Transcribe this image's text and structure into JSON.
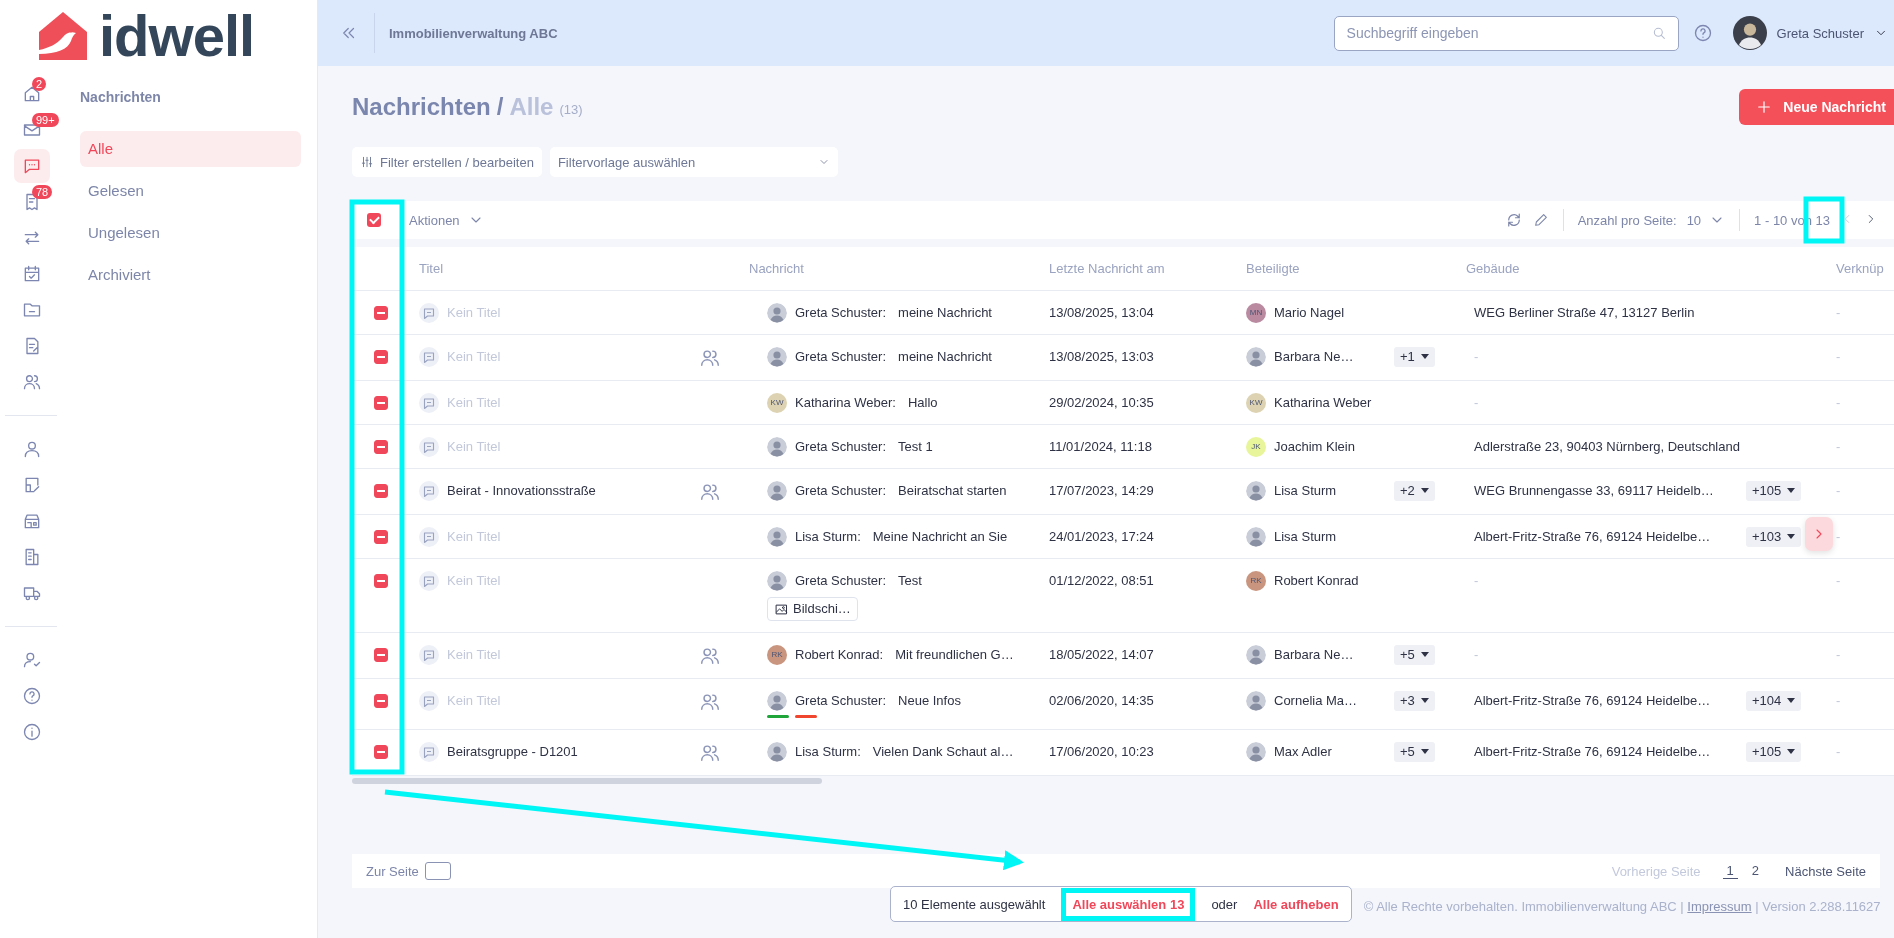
{
  "logo": {
    "text": "idwell"
  },
  "rail": {
    "groups": [
      [
        {
          "kind": "home",
          "badge": "2",
          "selected": false
        },
        {
          "kind": "mail",
          "badge": "99+",
          "selected": false
        },
        {
          "kind": "chat",
          "selected": true
        },
        {
          "kind": "receipt",
          "badge": "78",
          "selected": false
        },
        {
          "kind": "transfer",
          "selected": false
        },
        {
          "kind": "calendar",
          "selected": false
        },
        {
          "kind": "folder",
          "selected": false
        },
        {
          "kind": "document",
          "selected": false
        },
        {
          "kind": "users",
          "selected": false
        }
      ],
      [
        {
          "kind": "person",
          "selected": false
        },
        {
          "kind": "clipboard",
          "selected": false
        },
        {
          "kind": "store",
          "selected": false
        },
        {
          "kind": "building",
          "selected": false
        },
        {
          "kind": "truck",
          "selected": false
        }
      ],
      [
        {
          "kind": "usercheck",
          "selected": false
        },
        {
          "kind": "help",
          "selected": false
        },
        {
          "kind": "info",
          "selected": false
        }
      ]
    ]
  },
  "subnav": {
    "title": "Nachrichten",
    "items": [
      {
        "label": "Alle",
        "selected": true
      },
      {
        "label": "Gelesen",
        "selected": false
      },
      {
        "label": "Ungelesen",
        "selected": false
      },
      {
        "label": "Archiviert",
        "selected": false
      }
    ]
  },
  "header": {
    "account": "Immobilienverwaltung ABC",
    "search": {
      "placeholder": "Suchbegriff eingeben"
    },
    "user": {
      "name": "Greta Schuster"
    }
  },
  "page": {
    "title": "Nachrichten",
    "separator": "/",
    "subtitle": "Alle",
    "count": "(13)",
    "new_button": "Neue Nachricht"
  },
  "filters": {
    "edit_button": "Filter erstellen / bearbeiten",
    "template": {
      "placeholder": "Filtervorlage auswählen"
    }
  },
  "toolbar": {
    "all_checked": true,
    "actions": "Aktionen",
    "per_page_label": "Anzahl pro Seite:",
    "per_page": "10",
    "range": "1 - 10 von 13",
    "prev_disabled": true
  },
  "table": {
    "columns": [
      "Titel",
      "Nachricht",
      "Letzte Nachricht am",
      "Beteiligte",
      "Gebäude",
      "Verknüp"
    ],
    "rows": [
      {
        "selected": true,
        "title": "Kein Titel",
        "untitled": true,
        "group": false,
        "avatar": {
          "kind": "photo"
        },
        "sender": "Greta Schuster:",
        "message": "meine Nachricht",
        "date": "13/08/2025, 13:04",
        "participant": {
          "name": "Mario Nagel",
          "avatar": {
            "kind": "initials",
            "initials": "MN",
            "color": "#b98aa0"
          }
        },
        "building": "WEG Berliner Straße 47, 13127 Berlin",
        "linked": "-"
      },
      {
        "selected": true,
        "title": "Kein Titel",
        "untitled": true,
        "group": true,
        "avatar": {
          "kind": "photo"
        },
        "sender": "Greta Schuster:",
        "message": "meine Nachricht",
        "date": "13/08/2025, 13:03",
        "participant": {
          "name": "Barbara Ne…",
          "avatar": {
            "kind": "photo"
          }
        },
        "more_participants": "+1",
        "building": "-",
        "linked": "-"
      },
      {
        "selected": true,
        "title": "Kein Titel",
        "untitled": true,
        "group": false,
        "avatar": {
          "kind": "initials",
          "initials": "KW",
          "color": "#ddd3b3"
        },
        "sender": "Katharina Weber:",
        "message": "Hallo",
        "date": "29/02/2024, 10:35",
        "participant": {
          "name": "Katharina Weber",
          "avatar": {
            "kind": "initials",
            "initials": "KW",
            "color": "#ddd3b3"
          }
        },
        "building": "-",
        "linked": "-"
      },
      {
        "selected": true,
        "title": "Kein Titel",
        "untitled": true,
        "group": false,
        "avatar": {
          "kind": "photo"
        },
        "sender": "Greta Schuster:",
        "message": "Test 1",
        "date": "11/01/2024, 11:18",
        "participant": {
          "name": "Joachim Klein",
          "avatar": {
            "kind": "initials",
            "initials": "JK",
            "color": "#e8f59a"
          }
        },
        "building": "Adlerstraße 23, 90403 Nürnberg, Deutschland",
        "linked": "-"
      },
      {
        "selected": true,
        "title": "Beirat - Innovationsstraße",
        "untitled": false,
        "group": true,
        "avatar": {
          "kind": "photo"
        },
        "sender": "Greta Schuster:",
        "message": "Beiratschat starten",
        "date": "17/07/2023, 14:29",
        "participant": {
          "name": "Lisa Sturm",
          "avatar": {
            "kind": "photo"
          }
        },
        "more_participants": "+2",
        "building": "WEG Brunnengasse 33, 69117 Heidelb…",
        "more_buildings": "+105",
        "linked": "-"
      },
      {
        "selected": true,
        "title": "Kein Titel",
        "untitled": true,
        "group": false,
        "avatar": {
          "kind": "photo"
        },
        "sender": "Lisa Sturm:",
        "message": "Meine Nachricht an Sie",
        "date": "24/01/2023, 17:24",
        "participant": {
          "name": "Lisa Sturm",
          "avatar": {
            "kind": "photo"
          }
        },
        "building": "Albert-Fritz-Straße 76, 69124 Heidelbe…",
        "more_buildings": "+103",
        "linked": "-"
      },
      {
        "selected": true,
        "title": "Kein Titel",
        "untitled": true,
        "group": false,
        "avatar": {
          "kind": "photo"
        },
        "sender": "Greta Schuster:",
        "message": "Test",
        "attachment": "Bildschi…",
        "date": "01/12/2022, 08:51",
        "participant": {
          "name": "Robert Konrad",
          "avatar": {
            "kind": "initials",
            "initials": "RK",
            "color": "#c9957f"
          }
        },
        "building": "-",
        "linked": "-"
      },
      {
        "selected": true,
        "title": "Kein Titel",
        "untitled": true,
        "group": true,
        "avatar": {
          "kind": "initials",
          "initials": "RK",
          "color": "#c9957f"
        },
        "sender": "Robert Konrad:",
        "message": "Mit freundlichen G…",
        "date": "18/05/2022, 14:07",
        "participant": {
          "name": "Barbara Ne…",
          "avatar": {
            "kind": "photo"
          }
        },
        "more_participants": "+5",
        "building": "-",
        "linked": "-"
      },
      {
        "selected": true,
        "title": "Kein Titel",
        "untitled": true,
        "group": true,
        "avatar": {
          "kind": "photo"
        },
        "sender": "Greta Schuster:",
        "message": "Neue Infos",
        "tags": [
          {
            "color": "#1fa53a"
          },
          {
            "color": "#f0452f"
          }
        ],
        "date": "02/06/2020, 14:35",
        "participant": {
          "name": "Cornelia Ma…",
          "avatar": {
            "kind": "photo"
          }
        },
        "more_participants": "+3",
        "building": "Albert-Fritz-Straße 76, 69124 Heidelbe…",
        "more_buildings": "+104",
        "linked": "-"
      },
      {
        "selected": true,
        "title": "Beiratsgruppe - D1201",
        "untitled": false,
        "group": true,
        "avatar": {
          "kind": "photo"
        },
        "sender": "Lisa Sturm:",
        "message": "Vielen Dank Schaut al…",
        "date": "17/06/2020, 10:23",
        "participant": {
          "name": "Max Adler",
          "avatar": {
            "kind": "photo"
          }
        },
        "more_participants": "+5",
        "building": "Albert-Fritz-Straße 76, 69124 Heidelbe…",
        "more_buildings": "+105",
        "linked": "-"
      }
    ]
  },
  "pagination": {
    "goto_label": "Zur Seite",
    "prev": {
      "label": "Vorherige Seite",
      "disabled": true
    },
    "pages": [
      {
        "label": "1",
        "selected": true
      },
      {
        "label": "2",
        "selected": false
      }
    ],
    "next": {
      "label": "Nächste Seite",
      "disabled": false
    }
  },
  "selection_bar": {
    "text": "10 Elemente ausgewählt",
    "select_all": "Alle auswählen 13",
    "or": "oder",
    "clear": "Alle aufheben"
  },
  "footer": {
    "before": "© Alle Rechte vorbehalten. Immobilienverwaltung ABC |",
    "link": "Impressum",
    "after": "| Version 2.288.11627"
  }
}
